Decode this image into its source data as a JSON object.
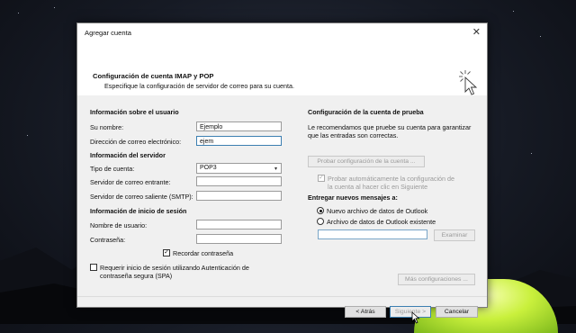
{
  "dialog": {
    "title": "Agregar cuenta",
    "heading": "Configuración de cuenta IMAP y POP",
    "subheading": "Especifique la configuración de servidor de correo para su cuenta."
  },
  "user_info": {
    "section": "Información sobre el usuario",
    "name_label": "Su nombre:",
    "name_value": "Ejemplo",
    "email_label": "Dirección de correo electrónico:",
    "email_value": "ejem"
  },
  "server_info": {
    "section": "Información del servidor",
    "account_type_label": "Tipo de cuenta:",
    "account_type_value": "POP3",
    "incoming_label": "Servidor de correo entrante:",
    "incoming_value": "",
    "outgoing_label": "Servidor de correo saliente (SMTP):",
    "outgoing_value": ""
  },
  "login_info": {
    "section": "Información de inicio de sesión",
    "username_label": "Nombre de usuario:",
    "username_value": "",
    "password_label": "Contraseña:",
    "password_value": "",
    "remember_label": "Recordar contraseña",
    "remember_checked": true,
    "spa_label_line1": "Requerir inicio de sesión utilizando Autenticación de",
    "spa_label_line2": "contraseña segura (SPA)",
    "spa_checked": false
  },
  "test": {
    "section": "Configuración de la cuenta de prueba",
    "desc_line1": "Le recomendamos que pruebe su cuenta para garantizar",
    "desc_line2": "que las entradas son correctas.",
    "test_button": "Probar configuración de la cuenta ...",
    "auto_test_line1": "Probar automáticamente la configuración de",
    "auto_test_line2": "la cuenta al hacer clic en Siguiente",
    "auto_test_checked": true
  },
  "deliver": {
    "section": "Entregar nuevos mensajes a:",
    "option_new": "Nuevo archivo de datos de Outlook",
    "option_existing": "Archivo de datos de Outlook existente",
    "selected": "option_new",
    "path_value": "",
    "browse_button": "Examinar"
  },
  "more_settings_button": "Más configuraciones ...",
  "footer": {
    "back": "< Atrás",
    "next": "Siguiente >",
    "cancel": "Cancelar"
  },
  "icons": {
    "close": "close-icon",
    "header_cursor": "cursor-click-icon",
    "dropdown": "chevron-down-icon",
    "mouse": "mouse-pointer-icon"
  },
  "colors": {
    "accent": "#3c7fb1",
    "tent_glow": "#c9f03c"
  }
}
